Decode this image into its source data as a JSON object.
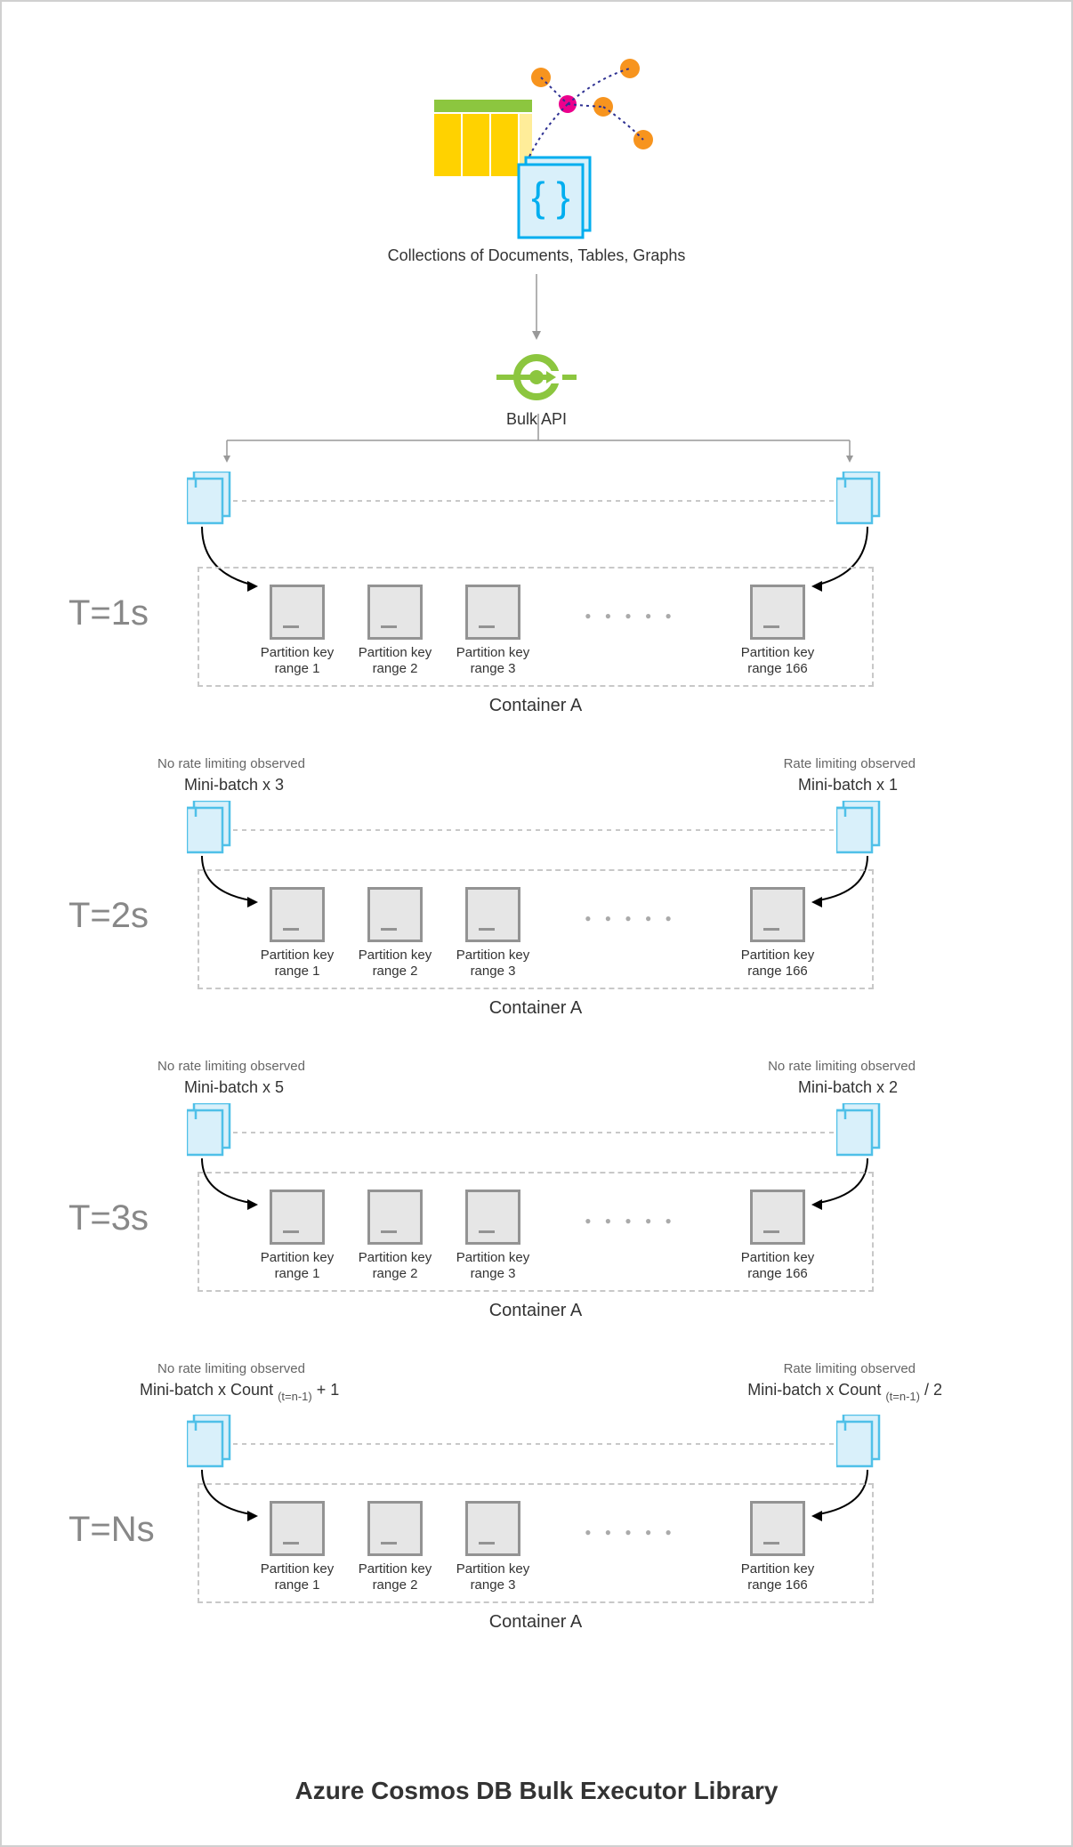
{
  "title": "Azure Cosmos DB Bulk Executor Library",
  "collections_label": "Collections of Documents, Tables, Graphs",
  "bulk_api_label": "Bulk API",
  "container_label": "Container A",
  "partitions": [
    "Partition key range 1",
    "Partition key range 2",
    "Partition key range 3",
    "Partition key range 166"
  ],
  "steps": [
    {
      "time": "T=1s",
      "left": {
        "note": "",
        "batch": ""
      },
      "right": {
        "note": "",
        "batch": ""
      }
    },
    {
      "time": "T=2s",
      "left": {
        "note": "No rate limiting observed",
        "batch": "Mini-batch x 3"
      },
      "right": {
        "note": "Rate limiting observed",
        "batch": "Mini-batch x 1"
      }
    },
    {
      "time": "T=3s",
      "left": {
        "note": "No rate limiting observed",
        "batch": "Mini-batch x 5"
      },
      "right": {
        "note": "No rate limiting observed",
        "batch": "Mini-batch x 2"
      }
    },
    {
      "time": "T=Ns",
      "left": {
        "note": "No rate limiting observed",
        "batch_prefix": "Mini-batch x Count ",
        "batch_sub": "(t=n-1)",
        "batch_suffix": " + 1"
      },
      "right": {
        "note": "Rate limiting observed",
        "batch_prefix": "Mini-batch x Count ",
        "batch_sub": "(t=n-1)",
        "batch_suffix": " / 2"
      }
    }
  ],
  "colors": {
    "doc_fill": "#d9f0fa",
    "doc_stroke": "#4fc0e8",
    "accent_green": "#8cc63f",
    "orange": "#f7941e",
    "magenta": "#ec008c",
    "yellow": "#ffd200"
  }
}
